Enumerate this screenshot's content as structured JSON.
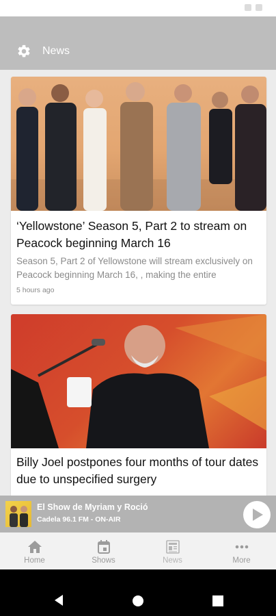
{
  "app_bar": {
    "title": "News",
    "settings_icon": "gear-icon"
  },
  "articles": [
    {
      "headline": "‘Yellowstone’ Season 5, Part 2 to stream on Peacock beginning March 16",
      "summary": "Season 5, Part 2 of Yellowstone will stream exclusively on Peacock beginning March 16, , making the entire",
      "time": "5 hours ago",
      "image": "cast-photo-orange-backdrop"
    },
    {
      "headline": "Billy Joel postpones four months of tour dates due to unspecified surgery",
      "image": "performer-at-piano-red-backdrop"
    }
  ],
  "player": {
    "show_title": "El Show de Myriam y Roció",
    "station": "Cadela 96.1 FM - ON-AIR",
    "play_icon": "play-icon"
  },
  "bottom_nav": {
    "items": [
      {
        "label": "Home",
        "icon": "home-icon"
      },
      {
        "label": "Shows",
        "icon": "calendar-icon"
      },
      {
        "label": "News",
        "icon": "news-icon",
        "active": true
      },
      {
        "label": "More",
        "icon": "more-icon"
      }
    ]
  },
  "colors": {
    "app_bar": "#bdbdbd",
    "player_bar": "#b3b3b3",
    "nav_bg": "#f2f2f2",
    "nav_text": "#9b9b9b",
    "summary_text": "#8a8a8a"
  }
}
